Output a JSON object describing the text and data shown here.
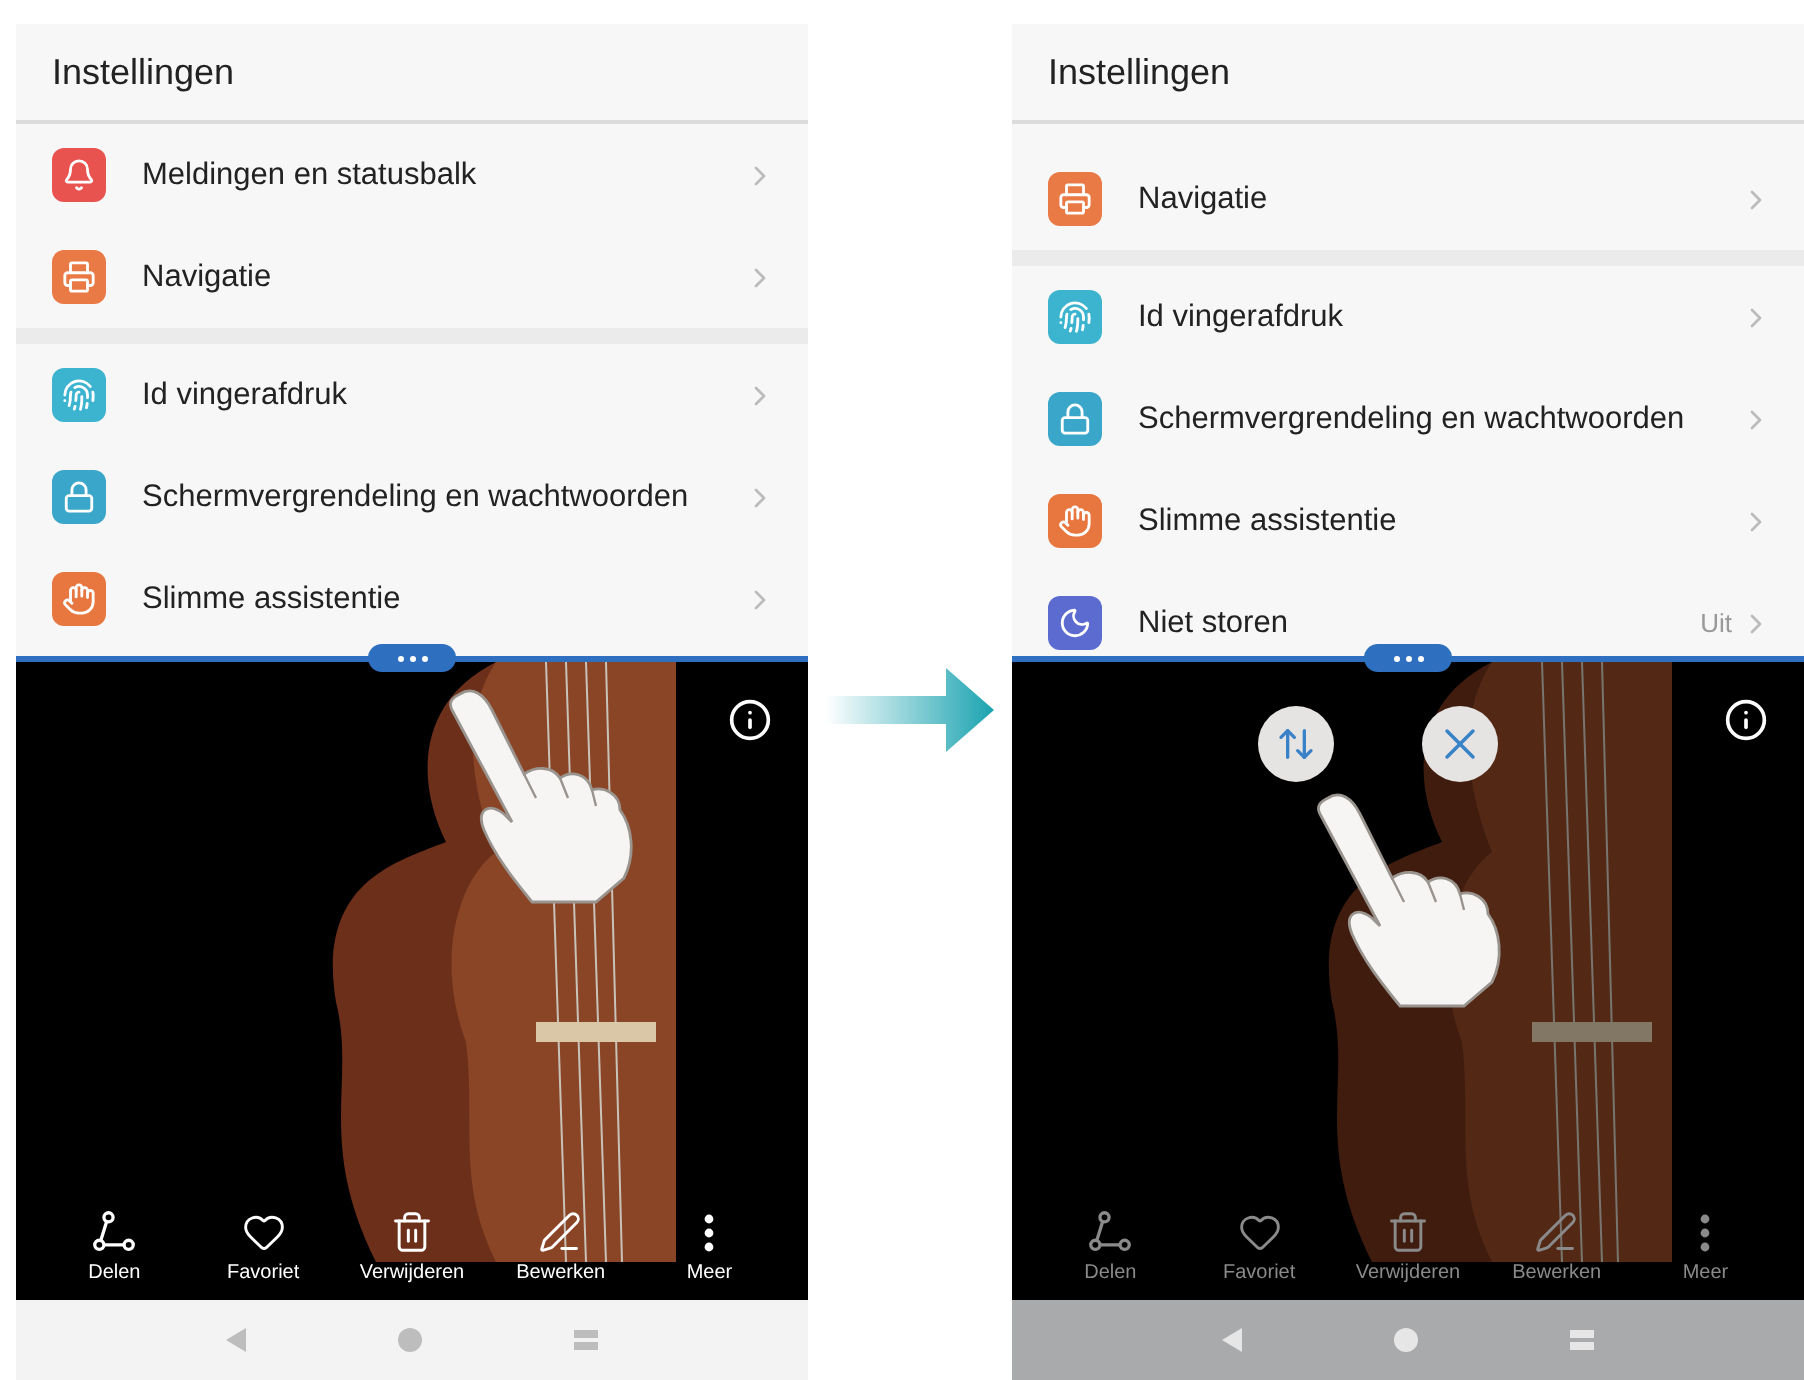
{
  "phones": [
    {
      "title": "Instellingen",
      "scrolled": false,
      "dimmed": false,
      "groups": [
        [
          {
            "kind": "notifications",
            "label": "Meldingen en statusbalk",
            "color": "#e8534f"
          },
          {
            "kind": "navigation",
            "label": "Navigatie",
            "color": "#e97a45"
          }
        ],
        [
          {
            "kind": "fingerprint",
            "label": "Id vingerafdruk",
            "color": "#3db4cf"
          },
          {
            "kind": "lock",
            "label": "Schermvergrendeling en wachtwoorden",
            "color": "#3aa6c9"
          },
          {
            "kind": "assist",
            "label": "Slimme assistentie",
            "color": "#e8763f"
          }
        ]
      ],
      "toolbar": [
        {
          "kind": "share",
          "label": "Delen"
        },
        {
          "kind": "favorite",
          "label": "Favoriet"
        },
        {
          "kind": "delete",
          "label": "Verwijderen"
        },
        {
          "kind": "edit",
          "label": "Bewerken"
        },
        {
          "kind": "more",
          "label": "Meer"
        }
      ]
    },
    {
      "title": "Instellingen",
      "scrolled": true,
      "dimmed": true,
      "groups": [
        [
          {
            "kind": "navigation",
            "label": "Navigatie",
            "color": "#e97a45"
          }
        ],
        [
          {
            "kind": "fingerprint",
            "label": "Id vingerafdruk",
            "color": "#3db4cf"
          },
          {
            "kind": "lock",
            "label": "Schermvergrendeling en wachtwoorden",
            "color": "#3aa6c9"
          },
          {
            "kind": "assist",
            "label": "Slimme assistentie",
            "color": "#e8763f"
          },
          {
            "kind": "dnd",
            "label": "Niet storen",
            "value": "Uit",
            "color": "#5b6bd0"
          }
        ]
      ],
      "overlay_buttons": [
        {
          "kind": "swap"
        },
        {
          "kind": "close"
        }
      ],
      "toolbar": [
        {
          "kind": "share",
          "label": "Delen"
        },
        {
          "kind": "favorite",
          "label": "Favoriet"
        },
        {
          "kind": "delete",
          "label": "Verwijderen"
        },
        {
          "kind": "edit",
          "label": "Bewerken"
        },
        {
          "kind": "more",
          "label": "Meer"
        }
      ]
    }
  ]
}
